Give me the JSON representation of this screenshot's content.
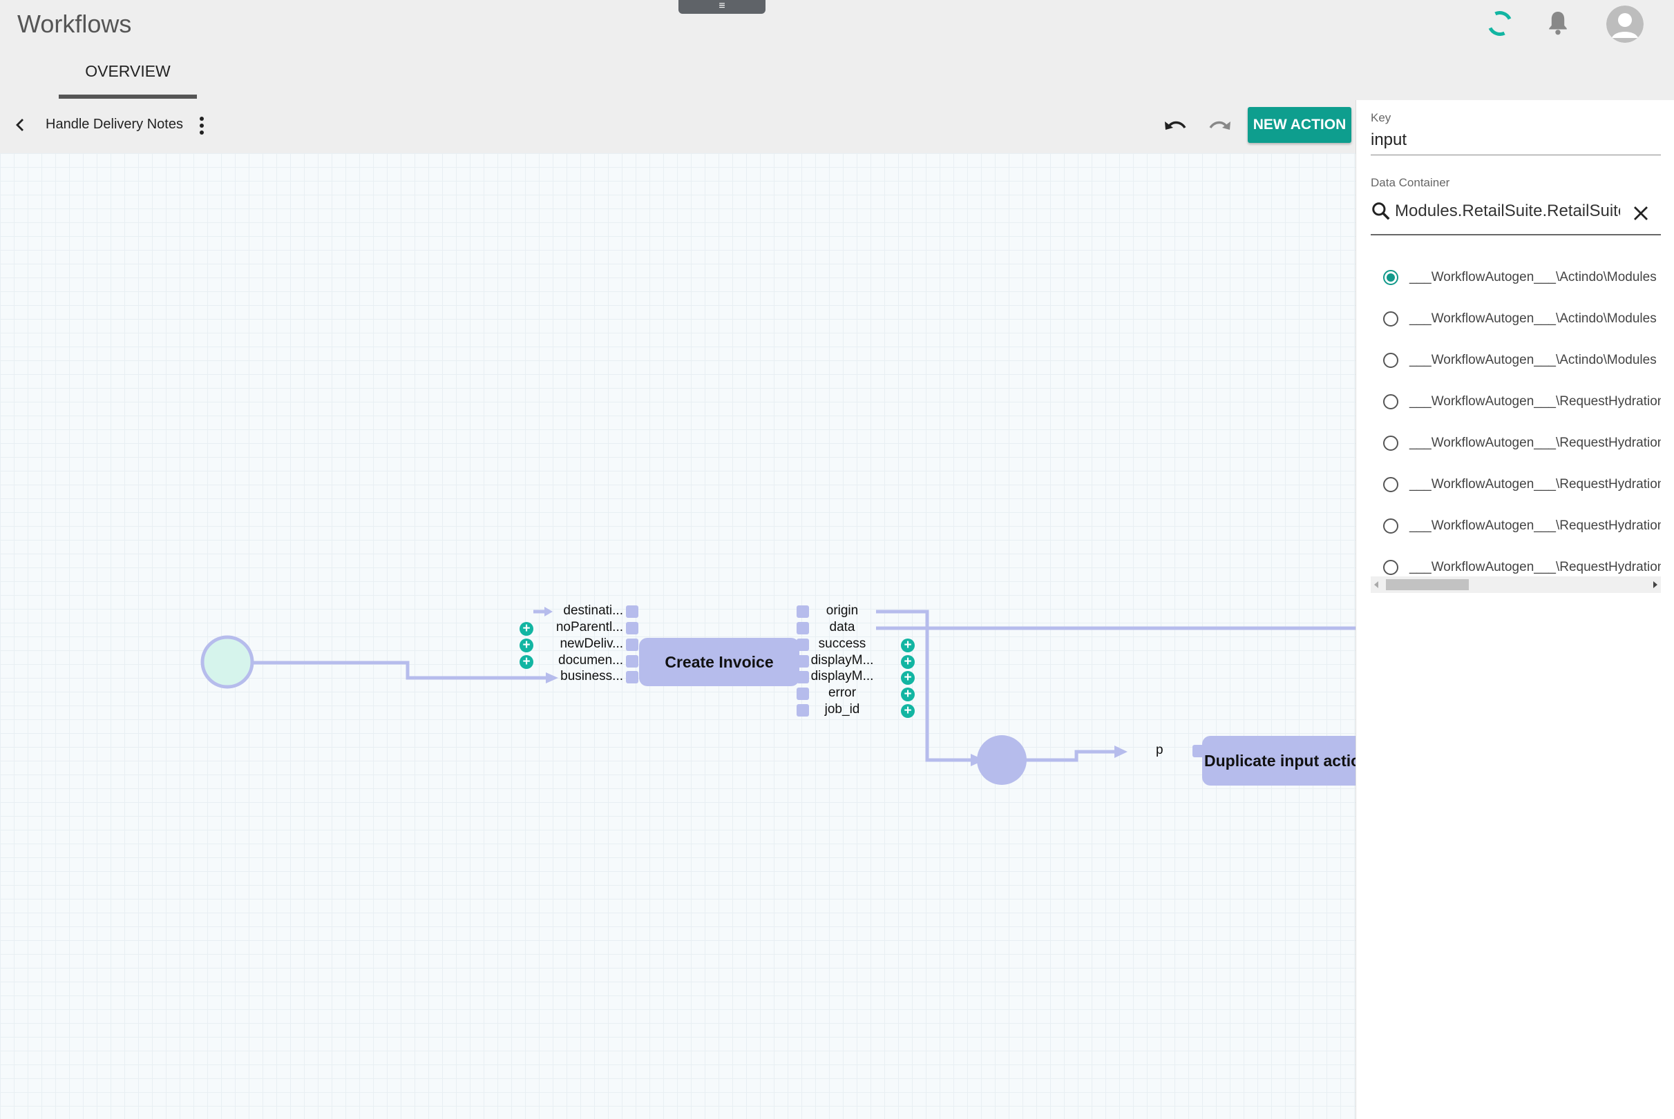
{
  "app": {
    "title": "Workflows",
    "handle_glyph": "≡",
    "tabs": [
      {
        "label": "OVERVIEW",
        "active": true
      }
    ],
    "header_icons": [
      "loading-spinner-icon",
      "bell-icon",
      "user-avatar-icon"
    ]
  },
  "toolbar": {
    "workflow_name": "Handle Delivery Notes",
    "icons": [
      "back-arrow-icon",
      "more-vert-icon",
      "undo-icon",
      "redo-icon"
    ],
    "new_action_label": "NEW ACTION",
    "accent_color": "#0e9e8e"
  },
  "panel": {
    "key_label": "Key",
    "key_value": "input",
    "data_container_label": "Data Container",
    "data_container_value": "Modules.RetailSuite.RetailSuite",
    "options": [
      {
        "label": "___WorkflowAutogen___\\Actindo\\Modules",
        "selected": true
      },
      {
        "label": "___WorkflowAutogen___\\Actindo\\Modules",
        "selected": false
      },
      {
        "label": "___WorkflowAutogen___\\Actindo\\Modules",
        "selected": false
      },
      {
        "label": "___WorkflowAutogen___\\RequestHydration",
        "selected": false
      },
      {
        "label": "___WorkflowAutogen___\\RequestHydration",
        "selected": false
      },
      {
        "label": "___WorkflowAutogen___\\RequestHydration",
        "selected": false
      },
      {
        "label": "___WorkflowAutogen___\\RequestHydration",
        "selected": false
      },
      {
        "label": "___WorkflowAutogen___\\RequestHydration",
        "selected": false
      }
    ]
  },
  "canvas": {
    "node_color": "#b6bcec",
    "start_node_color": "#d6f4ec",
    "add_color": "#12b5a2",
    "create_invoice": {
      "title": "Create Invoice",
      "inputs": [
        "destinati...",
        "noParentl...",
        "newDeliv...",
        "documen...",
        "business..."
      ],
      "outputs": [
        "origin",
        "data",
        "success",
        "displayM...",
        "displayM...",
        "error",
        "job_id"
      ]
    },
    "duplicate_node": {
      "title": "Duplicate input actio",
      "input": "p"
    },
    "add_glyph": "+"
  }
}
